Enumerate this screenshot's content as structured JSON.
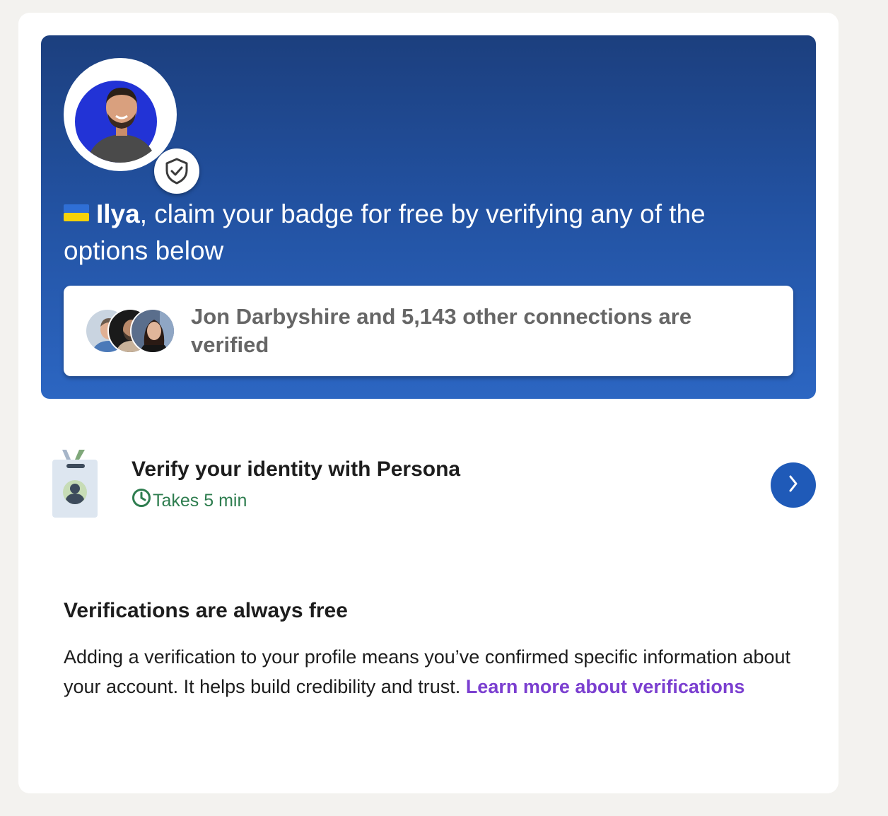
{
  "hero": {
    "flag_emoji": "ukraine-flag",
    "name": "Ilya",
    "headline_rest": ", claim your badge for free by verifying any of the options below",
    "shield_icon": "shield-check-icon"
  },
  "connections": {
    "text": "Jon Darbyshire and 5,143 other connections are verified",
    "avatars": [
      "connection-avatar-1",
      "connection-avatar-2",
      "connection-avatar-3"
    ]
  },
  "option": {
    "title": "Verify your identity with Persona",
    "time": "Takes 5 min",
    "icon": "id-badge-icon",
    "action_icon": "chevron-right-icon"
  },
  "info": {
    "title": "Verifications are always free",
    "body": "Adding a verification to your profile means you’ve confirmed specific information about your account. It helps build credibility and trust.",
    "link": "Learn more about verifications"
  },
  "colors": {
    "hero_top": "#1c3f7e",
    "hero_bottom": "#2c66c2",
    "accent_button": "#1f5ab8",
    "time_green": "#2e7d4f",
    "link_purple": "#7b3fd0"
  }
}
